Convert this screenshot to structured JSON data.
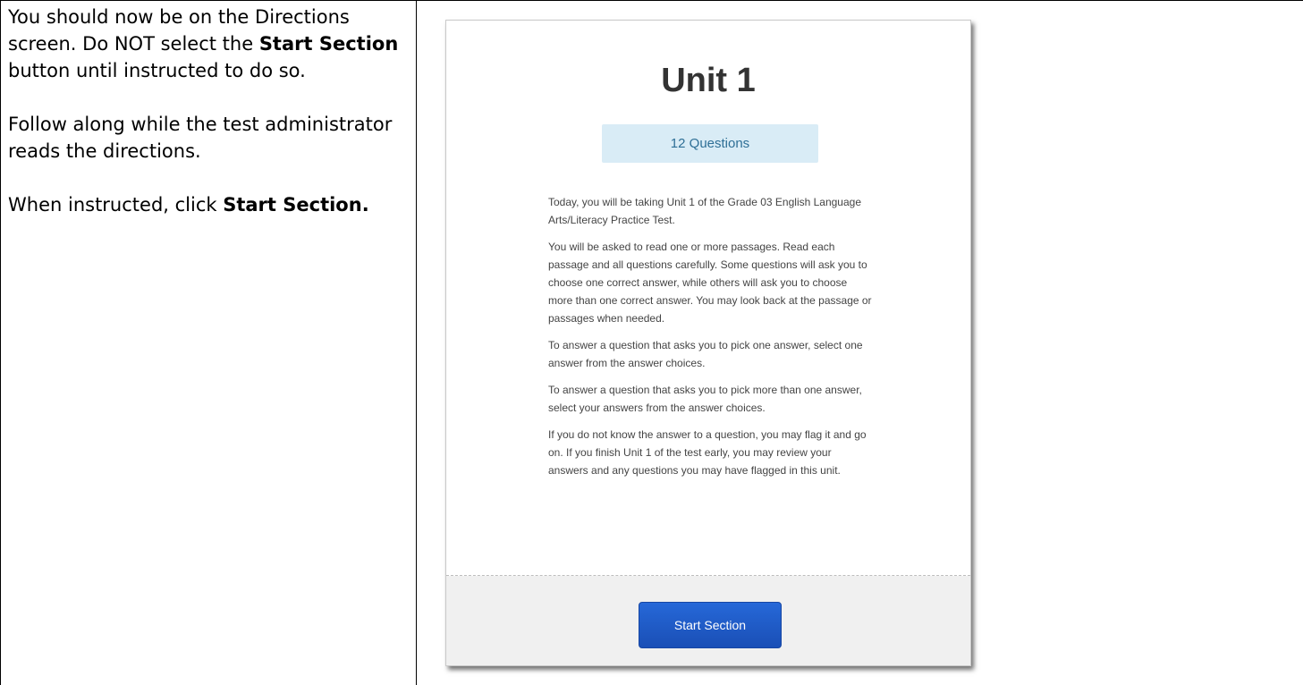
{
  "instructions": {
    "p1": {
      "a": "You should now be on the Directions screen. Do NOT select the ",
      "bold": "Start Section",
      "b": " button until instructed to do so."
    },
    "p2": "Follow along while the test administrator reads the directions.",
    "p3": {
      "a": "When instructed, click ",
      "bold": "Start Section."
    }
  },
  "directions_screen": {
    "title": "Unit 1",
    "question_count": "12 Questions",
    "paragraphs": [
      "Today, you will be taking Unit 1 of the Grade 03 English Language Arts/Literacy Practice Test.",
      "You will be asked to read one or more passages. Read each passage and all questions carefully. Some questions will ask you to choose one correct answer, while others will ask you to choose more than one correct answer. You may look back at the passage or passages when needed.",
      "To answer a question that asks you to pick one answer, select one answer from the answer choices.",
      "To answer a question that asks you to pick more than one answer, select your answers from the answer choices.",
      "If you do not know the answer to a question, you may flag it and go on. If you finish Unit 1 of the test early, you may review your answers and any questions you may have flagged in this unit."
    ],
    "start_button_label": "Start Section"
  },
  "colors": {
    "button": "#1d5bc9",
    "badge_bg": "#d9ecf6",
    "badge_text": "#2e6f96",
    "footer_bg": "#f0f0f0"
  }
}
